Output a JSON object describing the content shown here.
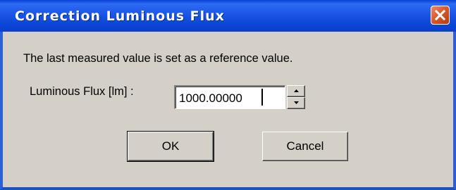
{
  "window": {
    "title": "Correction Luminous Flux",
    "close_icon": "close-icon"
  },
  "content": {
    "message": "The last measured value is set as a reference value.",
    "flux_label": "Luminous Flux [lm] :",
    "flux_value": "1000.00000"
  },
  "buttons": {
    "ok_label": "OK",
    "cancel_label": "Cancel"
  },
  "colors": {
    "titlebar": "#0b45d6",
    "dialog_background": "#d4d0c8",
    "close_button": "#d95a2e"
  }
}
